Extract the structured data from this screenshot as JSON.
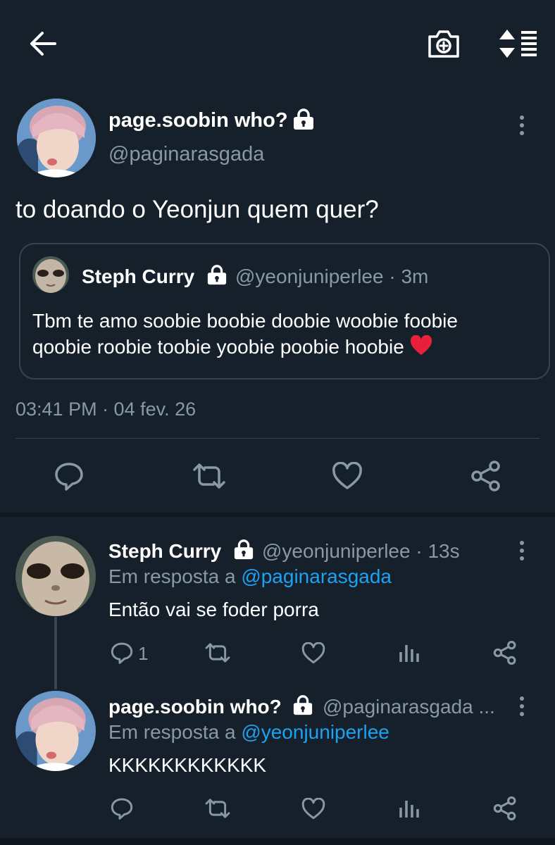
{
  "header": {
    "back_icon": "arrow-left-icon",
    "camera_icon": "camera-add-icon",
    "sort_icon": "sort-list-icon"
  },
  "main_tweet": {
    "author_name": "page.soobin who?",
    "author_handle": "@paginarasgada",
    "text": "to doando o Yeonjun quem quer?",
    "quoted": {
      "author_name": "Steph Curry",
      "author_handle": "@yeonjuniperlee",
      "time": "· 3m",
      "text_line1": "Tbm te amo soobie boobie doobie woobie foobie",
      "text_line2": "qoobie roobie toobie yoobie poobie hoobie"
    },
    "timestamp": "03:41 PM · 04 fev. 26"
  },
  "replies": [
    {
      "author_name": "Steph Curry",
      "author_handle": "@yeonjuniperlee",
      "time": "· 13s",
      "reply_prefix": "Em resposta a",
      "reply_to": "@paginarasgada",
      "text": "Então vai se foder porra",
      "reply_count": "1"
    },
    {
      "author_name": "page.soobin who?",
      "author_handle": "@paginarasgada ...",
      "reply_prefix": "Em resposta a",
      "reply_to": "@yeonjuniperlee",
      "text": "KKKKKKKKKKKK",
      "reply_count": ""
    }
  ],
  "colors": {
    "background": "#15202b",
    "muted": "#8899a6",
    "link": "#1da1f2",
    "divider": "#38444d",
    "heart": "#e0245e"
  }
}
